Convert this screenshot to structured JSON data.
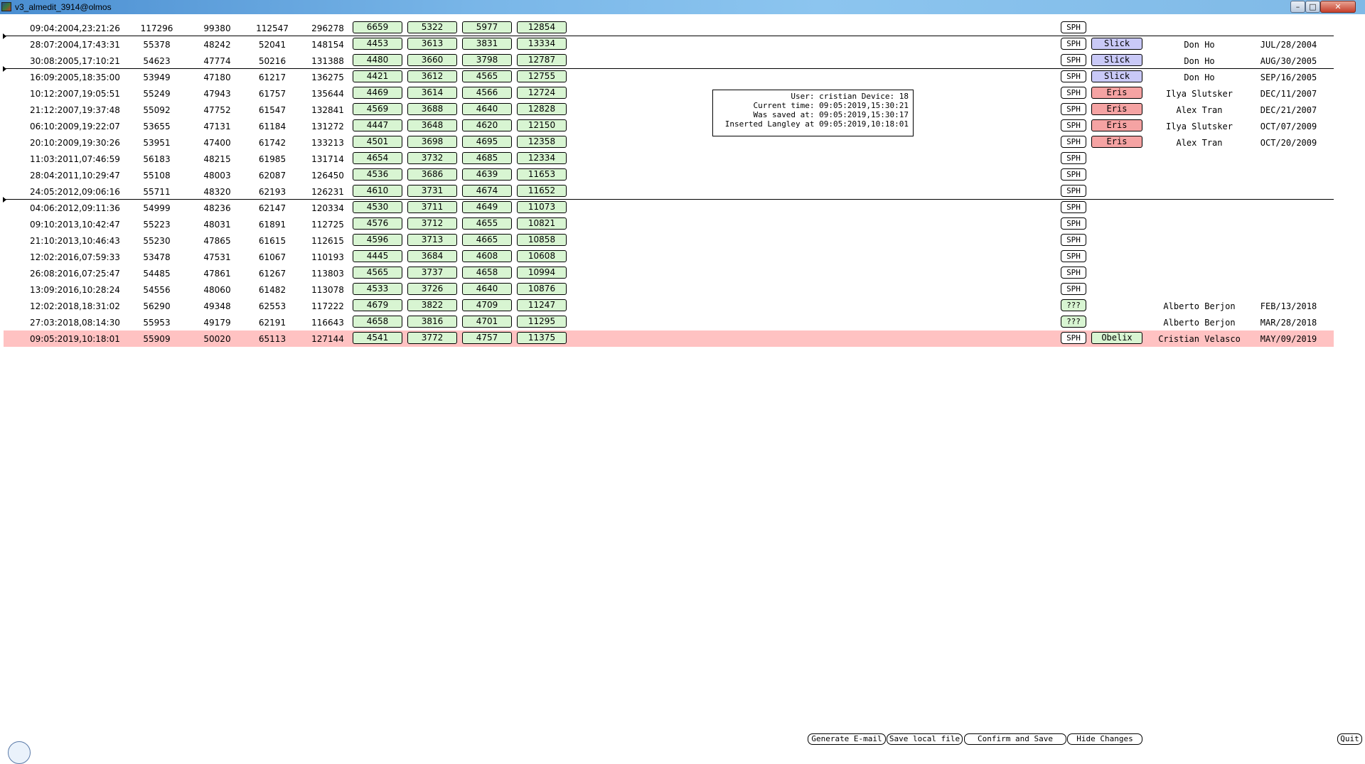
{
  "window": {
    "title": "v3_almedit_3914@olmos",
    "controls": {
      "minimize": "–",
      "maximize": "□",
      "close": "✕"
    }
  },
  "rows": [
    {
      "date": "09:04:2004,23:21:26",
      "n1": "117296",
      "n2": "99380",
      "n3": "112547",
      "n4": "296278",
      "g1": "6659",
      "g2": "5322",
      "g3": "5977",
      "g4": "12854",
      "sph": "SPH",
      "tag": "",
      "tag_color": "",
      "person": "",
      "person_date": ""
    },
    {
      "date": "28:07:2004,17:43:31",
      "n1": "55378",
      "n2": "48242",
      "n3": "52041",
      "n4": "148154",
      "g1": "4453",
      "g2": "3613",
      "g3": "3831",
      "g4": "13334",
      "sph": "SPH",
      "tag": "Slick",
      "tag_color": "blue",
      "person": "Don Ho",
      "person_date": "JUL/28/2004"
    },
    {
      "date": "30:08:2005,17:10:21",
      "n1": "54623",
      "n2": "47774",
      "n3": "50216",
      "n4": "131388",
      "g1": "4480",
      "g2": "3660",
      "g3": "3798",
      "g4": "12787",
      "sph": "SPH",
      "tag": "Slick",
      "tag_color": "blue",
      "person": "Don Ho",
      "person_date": "AUG/30/2005"
    },
    {
      "date": "16:09:2005,18:35:00",
      "n1": "53949",
      "n2": "47180",
      "n3": "61217",
      "n4": "136275",
      "g1": "4421",
      "g2": "3612",
      "g3": "4565",
      "g4": "12755",
      "sph": "SPH",
      "tag": "Slick",
      "tag_color": "blue",
      "person": "Don Ho",
      "person_date": "SEP/16/2005"
    },
    {
      "date": "10:12:2007,19:05:51",
      "n1": "55249",
      "n2": "47943",
      "n3": "61757",
      "n4": "135644",
      "g1": "4469",
      "g2": "3614",
      "g3": "4566",
      "g4": "12724",
      "sph": "SPH",
      "tag": "Eris",
      "tag_color": "red",
      "person": "Ilya Slutsker",
      "person_date": "DEC/11/2007"
    },
    {
      "date": "21:12:2007,19:37:48",
      "n1": "55092",
      "n2": "47752",
      "n3": "61547",
      "n4": "132841",
      "g1": "4569",
      "g2": "3688",
      "g3": "4640",
      "g4": "12828",
      "sph": "SPH",
      "tag": "Eris",
      "tag_color": "red",
      "person": "Alex Tran",
      "person_date": "DEC/21/2007"
    },
    {
      "date": "06:10:2009,19:22:07",
      "n1": "53655",
      "n2": "47131",
      "n3": "61184",
      "n4": "131272",
      "g1": "4447",
      "g2": "3648",
      "g3": "4620",
      "g4": "12150",
      "sph": "SPH",
      "tag": "Eris",
      "tag_color": "red",
      "person": "Ilya Slutsker",
      "person_date": "OCT/07/2009"
    },
    {
      "date": "20:10:2009,19:30:26",
      "n1": "53951",
      "n2": "47400",
      "n3": "61742",
      "n4": "133213",
      "g1": "4501",
      "g2": "3698",
      "g3": "4695",
      "g4": "12358",
      "sph": "SPH",
      "tag": "Eris",
      "tag_color": "red",
      "person": "Alex Tran",
      "person_date": "OCT/20/2009"
    },
    {
      "date": "11:03:2011,07:46:59",
      "n1": "56183",
      "n2": "48215",
      "n3": "61985",
      "n4": "131714",
      "g1": "4654",
      "g2": "3732",
      "g3": "4685",
      "g4": "12334",
      "sph": "SPH",
      "tag": "",
      "tag_color": "",
      "person": "",
      "person_date": ""
    },
    {
      "date": "28:04:2011,10:29:47",
      "n1": "55108",
      "n2": "48003",
      "n3": "62087",
      "n4": "126450",
      "g1": "4536",
      "g2": "3686",
      "g3": "4639",
      "g4": "11653",
      "sph": "SPH",
      "tag": "",
      "tag_color": "",
      "person": "",
      "person_date": ""
    },
    {
      "date": "24:05:2012,09:06:16",
      "n1": "55711",
      "n2": "48320",
      "n3": "62193",
      "n4": "126231",
      "g1": "4610",
      "g2": "3731",
      "g3": "4674",
      "g4": "11652",
      "sph": "SPH",
      "tag": "",
      "tag_color": "",
      "person": "",
      "person_date": ""
    },
    {
      "date": "04:06:2012,09:11:36",
      "n1": "54999",
      "n2": "48236",
      "n3": "62147",
      "n4": "120334",
      "g1": "4530",
      "g2": "3711",
      "g3": "4649",
      "g4": "11073",
      "sph": "SPH",
      "tag": "",
      "tag_color": "",
      "person": "",
      "person_date": ""
    },
    {
      "date": "09:10:2013,10:42:47",
      "n1": "55223",
      "n2": "48031",
      "n3": "61891",
      "n4": "112725",
      "g1": "4576",
      "g2": "3712",
      "g3": "4655",
      "g4": "10821",
      "sph": "SPH",
      "tag": "",
      "tag_color": "",
      "person": "",
      "person_date": ""
    },
    {
      "date": "21:10:2013,10:46:43",
      "n1": "55230",
      "n2": "47865",
      "n3": "61615",
      "n4": "112615",
      "g1": "4596",
      "g2": "3713",
      "g3": "4665",
      "g4": "10858",
      "sph": "SPH",
      "tag": "",
      "tag_color": "",
      "person": "",
      "person_date": ""
    },
    {
      "date": "12:02:2016,07:59:33",
      "n1": "53478",
      "n2": "47531",
      "n3": "61067",
      "n4": "110193",
      "g1": "4445",
      "g2": "3684",
      "g3": "4608",
      "g4": "10608",
      "sph": "SPH",
      "tag": "",
      "tag_color": "",
      "person": "",
      "person_date": ""
    },
    {
      "date": "26:08:2016,07:25:47",
      "n1": "54485",
      "n2": "47861",
      "n3": "61267",
      "n4": "113803",
      "g1": "4565",
      "g2": "3737",
      "g3": "4658",
      "g4": "10994",
      "sph": "SPH",
      "tag": "",
      "tag_color": "",
      "person": "",
      "person_date": ""
    },
    {
      "date": "13:09:2016,10:28:24",
      "n1": "54556",
      "n2": "48060",
      "n3": "61482",
      "n4": "113078",
      "g1": "4533",
      "g2": "3726",
      "g3": "4640",
      "g4": "10876",
      "sph": "SPH",
      "tag": "",
      "tag_color": "",
      "person": "",
      "person_date": ""
    },
    {
      "date": "12:02:2018,18:31:02",
      "n1": "56290",
      "n2": "49348",
      "n3": "62553",
      "n4": "117222",
      "g1": "4679",
      "g2": "3822",
      "g3": "4709",
      "g4": "11247",
      "sph": "???",
      "tag": "",
      "tag_color": "",
      "person": "Alberto Berjon",
      "person_date": "FEB/13/2018"
    },
    {
      "date": "27:03:2018,08:14:30",
      "n1": "55953",
      "n2": "49179",
      "n3": "62191",
      "n4": "116643",
      "g1": "4658",
      "g2": "3816",
      "g3": "4701",
      "g4": "11295",
      "sph": "???",
      "tag": "",
      "tag_color": "",
      "person": "Alberto Berjon",
      "person_date": "MAR/28/2018"
    },
    {
      "date": "09:05:2019,10:18:01",
      "n1": "55909",
      "n2": "50020",
      "n3": "65113",
      "n4": "127144",
      "g1": "4541",
      "g2": "3772",
      "g3": "4757",
      "g4": "11375",
      "sph": "SPH",
      "tag": "Obelix",
      "tag_color": "green",
      "person": "Cristian Velasco",
      "person_date": "MAY/09/2019",
      "highlight": true
    }
  ],
  "separators_after_row": [
    0,
    2,
    10
  ],
  "info_box": {
    "line1": "User: cristian Device: 18",
    "line2": "Current time: 09:05:2019,15:30:21",
    "line3": "Was saved at: 09:05:2019,15:30:17",
    "line4": "Inserted Langley at 09:05:2019,10:18:01"
  },
  "buttons": {
    "generate_email": "Generate E-mail",
    "save_local": "Save local file",
    "confirm_save": "Confirm and Save",
    "hide_changes": "Hide Changes",
    "quit": "Quit"
  },
  "colors": {
    "green_cell": "#d8f5d2",
    "tag_blue": "#c9c9f7",
    "tag_red": "#f5a3a3",
    "highlight_row": "#ffc2c2"
  }
}
